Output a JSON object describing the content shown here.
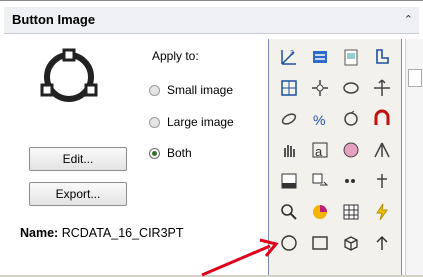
{
  "panel": {
    "title": "Button Image",
    "apply_label": "Apply to:",
    "options": [
      "Small image",
      "Large image",
      "Both"
    ],
    "selected": "Both",
    "edit_label": "Edit...",
    "export_label": "Export...",
    "name_label": "Name:",
    "name_value": "RCDATA_16_CIR3PT"
  },
  "icons": [
    "angle-dimension-icon",
    "3d-blue-icon",
    "clipboard-image-icon",
    "chair-shape-icon",
    "grid-blue-icon",
    "compass-arrows-icon",
    "rotate-3d-icon",
    "move-arrows-icon",
    "orbit-icon",
    "percent-icon",
    "spin-arrows-icon",
    "magnet-icon",
    "pan-hand-icon",
    "layer-a-icon",
    "globe-icon",
    "tripod-icon",
    "table-icon",
    "copy-arrow-icon",
    "dots-icon",
    "bulb-arrows-icon",
    "magnifier-icon",
    "pie-chart-icon",
    "grid-table-icon",
    "lightning-icon",
    "circle-3pt-icon",
    "rectangle-icon",
    "box-3d-icon",
    "arrow-up-icon"
  ],
  "colors": {
    "accent": "#e0001b",
    "selected_radio": "#2f6f2f",
    "panel_border": "#7c8db4"
  }
}
